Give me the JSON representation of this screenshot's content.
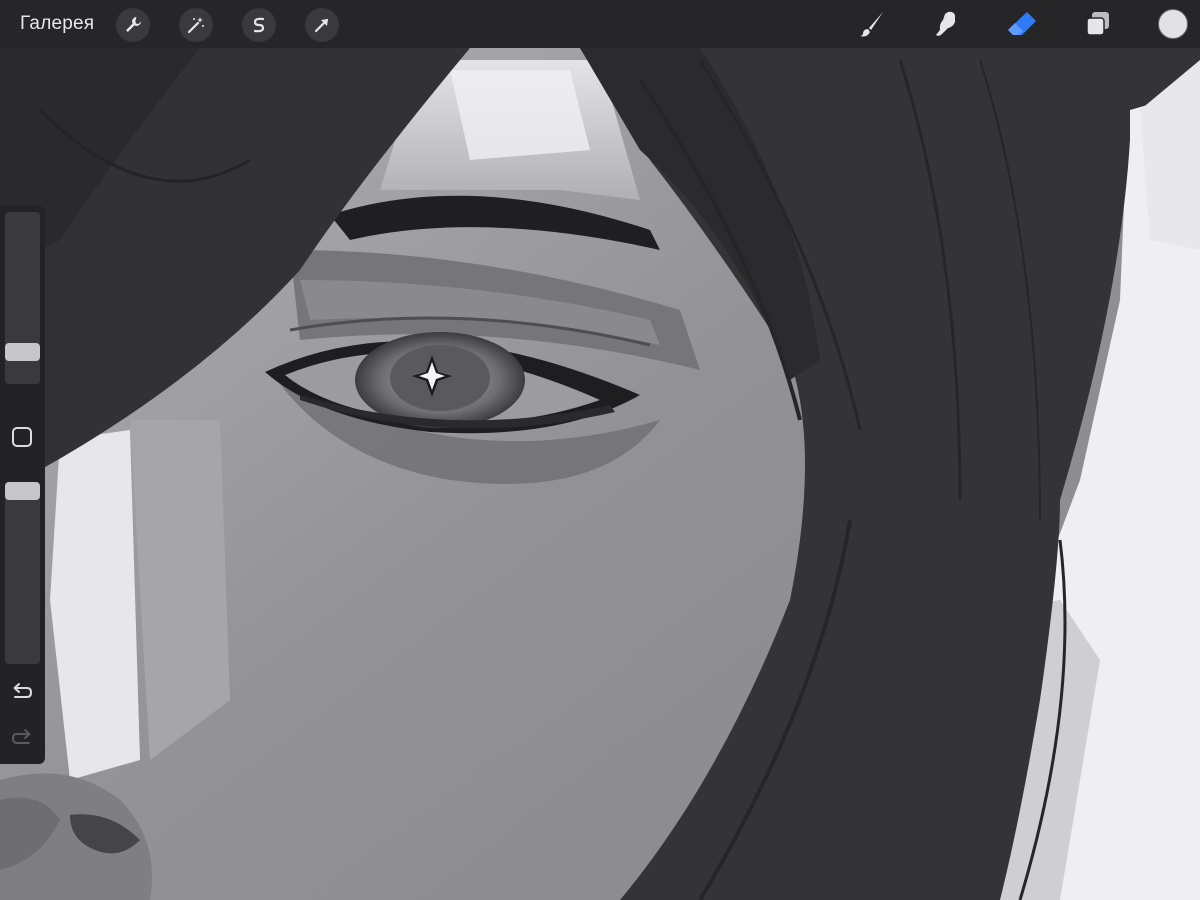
{
  "toolbar": {
    "gallery_label": "Галерея",
    "left_tools": [
      {
        "name": "actions",
        "icon": "wrench-icon"
      },
      {
        "name": "adjustments",
        "icon": "magic-wand-icon"
      },
      {
        "name": "selection",
        "icon": "selection-s-icon"
      },
      {
        "name": "transform",
        "icon": "arrow-cursor-icon"
      }
    ],
    "right_tools": [
      {
        "name": "brush",
        "icon": "brush-icon",
        "active": false
      },
      {
        "name": "smudge",
        "icon": "smudge-finger-icon",
        "active": false
      },
      {
        "name": "eraser",
        "icon": "eraser-icon",
        "active": true
      },
      {
        "name": "layers",
        "icon": "layers-icon",
        "active": false
      }
    ],
    "active_tool_color": "#2f7bf5",
    "current_color": "#e2e2e4"
  },
  "sidebar": {
    "brush_size_level": 0.15,
    "opacity_level": 1.0,
    "modify_icon": "square-modify-icon",
    "undo_icon": "undo-arrow-icon",
    "redo_icon": "redo-arrow-icon",
    "redo_enabled": false
  }
}
